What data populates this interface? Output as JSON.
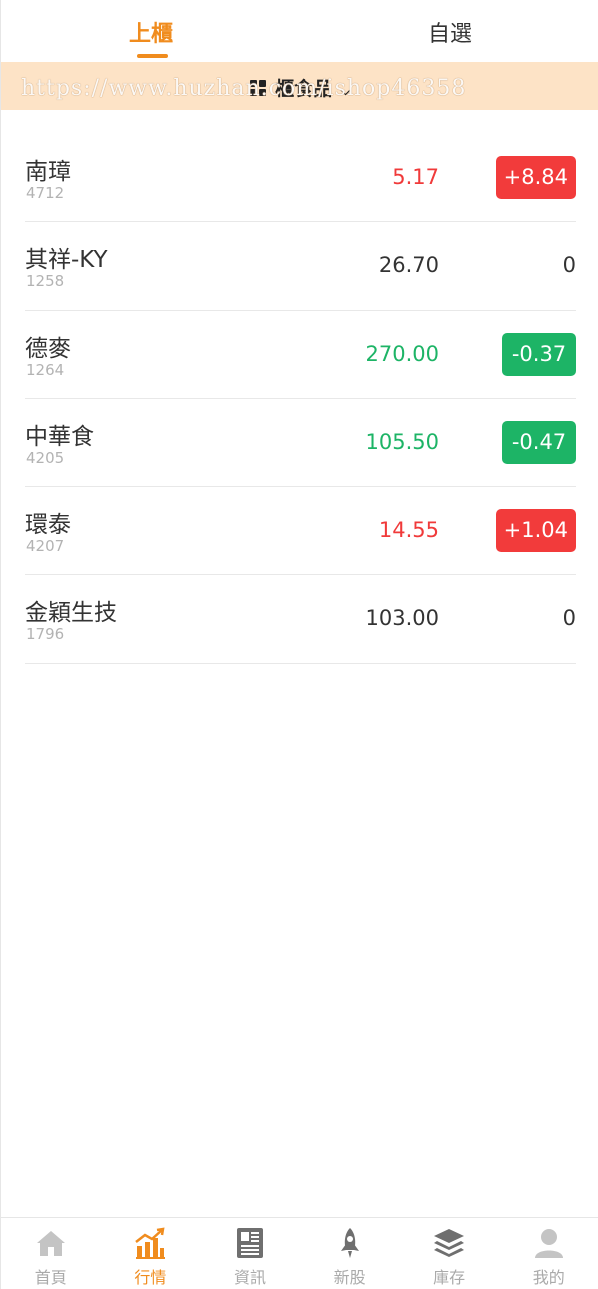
{
  "tabs": {
    "left": "上櫃",
    "right": "自選",
    "active": "left"
  },
  "category": {
    "label": "櫃食品",
    "icon": "grid-icon",
    "dropdown_icon": "chevron-down-icon"
  },
  "watermark": "https://www.huzhan.com/ishop46358",
  "colors": {
    "accent": "#f08c1e",
    "up": "#f03a3a",
    "down": "#1db466",
    "category_bar": "#fde3c6"
  },
  "stocks": [
    {
      "name": "南璋",
      "code": "4712",
      "price": "5.17",
      "change": "+8.84",
      "trend": "up"
    },
    {
      "name": "其祥-KY",
      "code": "1258",
      "price": "26.70",
      "change": "0",
      "trend": "flat"
    },
    {
      "name": "德麥",
      "code": "1264",
      "price": "270.00",
      "change": "-0.37",
      "trend": "down"
    },
    {
      "name": "中華食",
      "code": "4205",
      "price": "105.50",
      "change": "-0.47",
      "trend": "down"
    },
    {
      "name": "環泰",
      "code": "4207",
      "price": "14.55",
      "change": "+1.04",
      "trend": "up"
    },
    {
      "name": "金穎生技",
      "code": "1796",
      "price": "103.00",
      "change": "0",
      "trend": "flat"
    }
  ],
  "nav": [
    {
      "label": "首頁",
      "icon": "home-icon",
      "active": false
    },
    {
      "label": "行情",
      "icon": "chart-icon",
      "active": true
    },
    {
      "label": "資訊",
      "icon": "news-icon",
      "active": false
    },
    {
      "label": "新股",
      "icon": "rocket-icon",
      "active": false
    },
    {
      "label": "庫存",
      "icon": "layers-icon",
      "active": false
    },
    {
      "label": "我的",
      "icon": "user-icon",
      "active": false
    }
  ]
}
